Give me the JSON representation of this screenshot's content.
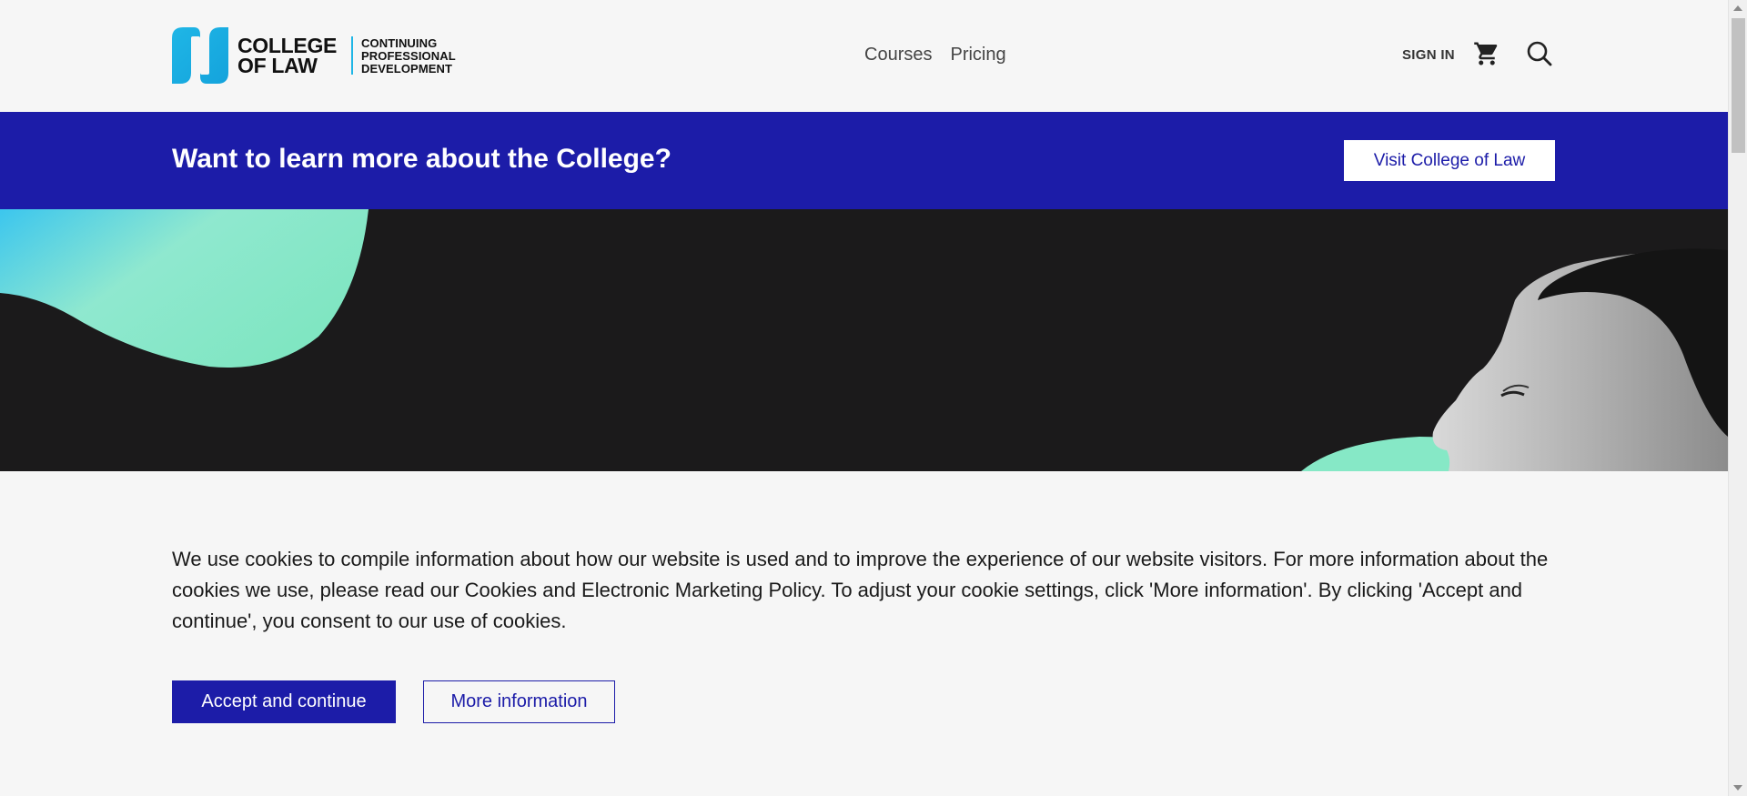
{
  "header": {
    "logo": {
      "primary": "COLLEGE OF LAW",
      "secondary_lines": [
        "CONTINUING",
        "PROFESSIONAL",
        "DEVELOPMENT"
      ]
    },
    "nav": [
      {
        "label": "Courses"
      },
      {
        "label": "Pricing"
      }
    ],
    "signin_label": "SIGN IN",
    "cart_icon": "cart-icon",
    "search_icon": "search-icon"
  },
  "banner": {
    "title": "Want to learn more about the College?",
    "button_label": "Visit College of Law"
  },
  "cookie": {
    "text": "We use cookies to compile information about how our website is used and to improve the experience of our website visitors. For more information about the cookies we use, please read our Cookies and Electronic Marketing Policy. To adjust your cookie settings, click 'More information'. By clicking 'Accept and continue', you consent to our use of cookies.",
    "accept_label": "Accept and continue",
    "more_label": "More information"
  },
  "colors": {
    "brand_blue": "#1c1ca8",
    "logo_cyan": "#1fb6e6",
    "hero_bg": "#1b1a1b",
    "mint": "#86e8c6"
  }
}
